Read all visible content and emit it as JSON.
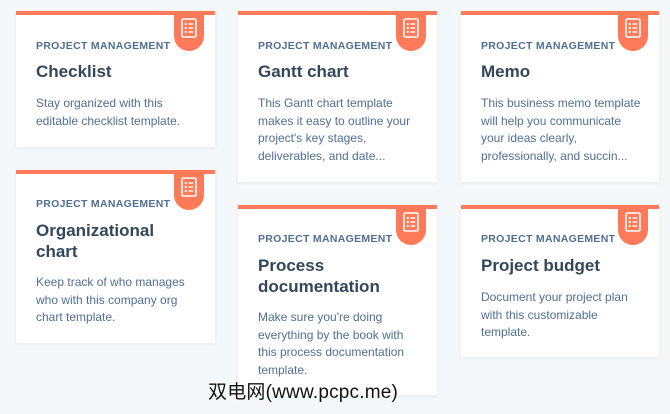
{
  "colors": {
    "accent": "#ff7a59",
    "card_background": "#ffffff",
    "page_background": "#f5f8fa",
    "title": "#33475b",
    "body_text": "#516f90"
  },
  "cards": [
    {
      "category": "PROJECT MANAGEMENT",
      "title": "Checklist",
      "description": "Stay organized with this editable checklist template.",
      "icon": "document-list-icon"
    },
    {
      "category": "PROJECT MANAGEMENT",
      "title": "Gantt chart",
      "description": "This Gantt chart template makes it easy to outline your project's key stages, deliverables, and date...",
      "icon": "document-list-icon"
    },
    {
      "category": "PROJECT MANAGEMENT",
      "title": "Memo",
      "description": "This business memo template will help you communicate your ideas clearly, professionally, and succin...",
      "icon": "document-list-icon"
    },
    {
      "category": "PROJECT MANAGEMENT",
      "title": "Organizational chart",
      "description": "Keep track of who manages who with this company org chart template.",
      "icon": "document-list-icon"
    },
    {
      "category": "PROJECT MANAGEMENT",
      "title": "Process documentation",
      "description": "Make sure you're doing everything by the book with this process documentation template.",
      "icon": "document-list-icon"
    },
    {
      "category": "PROJECT MANAGEMENT",
      "title": "Project budget",
      "description": "Document your project plan with this customizable template.",
      "icon": "document-list-icon"
    }
  ],
  "watermark": "双电网(www.pcpc.me)"
}
